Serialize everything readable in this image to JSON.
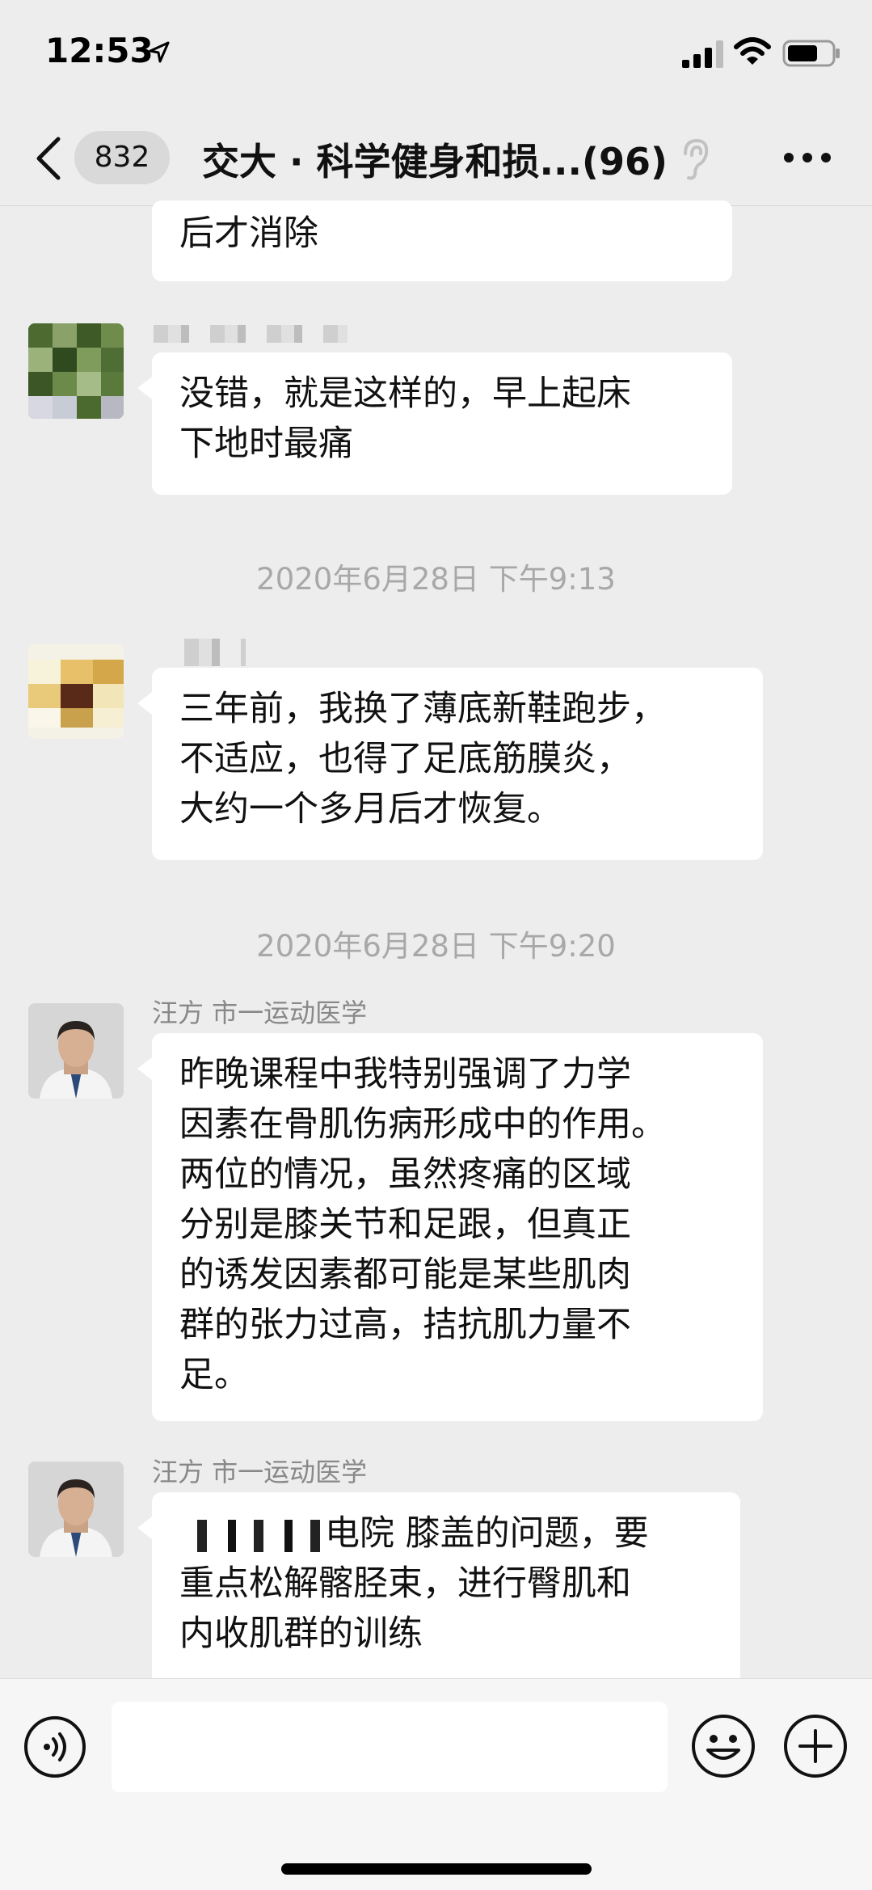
{
  "status_bar": {
    "time": "12:53"
  },
  "nav": {
    "unread_count": "832",
    "title": "交大 · 科学健身和损...(96)"
  },
  "messages": [
    {
      "text": "后才消除"
    },
    {
      "text": "没错，就是这样的，早上起床\n下地时最痛"
    },
    {
      "timestamp": "2020年6月28日 下午9:13"
    },
    {
      "text": "三年前，我换了薄底新鞋跑步，\n不适应，也得了足底筋膜炎，\n大约一个多月后才恢复。"
    },
    {
      "timestamp": "2020年6月28日 下午9:20"
    },
    {
      "sender": "汪方 市一运动医学",
      "text": "昨晚课程中我特别强调了力学\n因素在骨肌伤病形成中的作用。\n两位的情况，虽然疼痛的区域\n分别是膝关节和足跟，但真正\n的诱发因素都可能是某些肌肉\n群的张力过高，拮抗肌力量不\n足。"
    },
    {
      "sender": "汪方 市一运动医学",
      "text": "电院 膝盖的问题，要\n重点松解髂胫束，进行臀肌和\n内收肌群的训练"
    }
  ],
  "input_bar": {
    "placeholder": ""
  },
  "colors": {
    "background": "#ededed",
    "bubble": "#ffffff",
    "timestamp": "#a8a8a8",
    "sender": "#888888"
  }
}
